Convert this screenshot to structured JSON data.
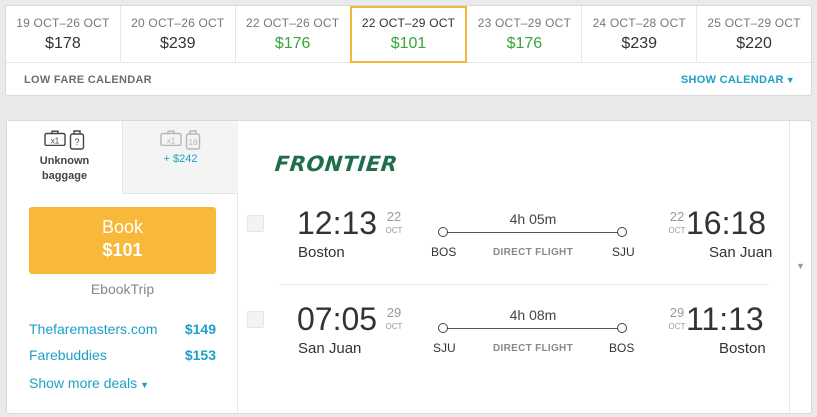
{
  "calendar": {
    "dates": [
      {
        "range": "19 OCT–26 OCT",
        "price": "$178",
        "cheap": false,
        "selected": false
      },
      {
        "range": "20 OCT–26 OCT",
        "price": "$239",
        "cheap": false,
        "selected": false
      },
      {
        "range": "22 OCT–26 OCT",
        "price": "$176",
        "cheap": true,
        "selected": false
      },
      {
        "range": "22 OCT–29 OCT",
        "price": "$101",
        "cheap": true,
        "selected": true
      },
      {
        "range": "23 OCT–29 OCT",
        "price": "$176",
        "cheap": true,
        "selected": false
      },
      {
        "range": "24 OCT–28 OCT",
        "price": "$239",
        "cheap": false,
        "selected": false
      },
      {
        "range": "25 OCT–29 OCT",
        "price": "$220",
        "cheap": false,
        "selected": false
      }
    ],
    "label": "LOW FARE CALENDAR",
    "show_label": "SHOW CALENDAR",
    "show_icon": "chevron-down-icon",
    "colors": {
      "cheap": "#3aa43a",
      "selected_border": "#f5b73b",
      "link": "#1ba0c8"
    }
  },
  "result": {
    "baggage": {
      "active_label": "Unknown baggage",
      "active_badge_1": "x1",
      "active_badge_2": "?",
      "inactive_badge_1": "x1",
      "inactive_badge_2": "18",
      "inactive_extra": "+ $242"
    },
    "book": {
      "label": "Book",
      "price": "$101",
      "color": "#f8b83a"
    },
    "provider": "EbookTrip",
    "deals": [
      {
        "name": "Thefaremasters.com",
        "price": "$149"
      },
      {
        "name": "Farebuddies",
        "price": "$153"
      }
    ],
    "more_deals": "Show more deals",
    "airline": "FRONTIER",
    "legs": [
      {
        "depart_time": "12:13",
        "depart_day": "22",
        "depart_month": "OCT",
        "depart_city": "Boston",
        "duration": "4h 05m",
        "from_code": "BOS",
        "to_code": "SJU",
        "stops": "DIRECT FLIGHT",
        "arrive_day": "22",
        "arrive_month": "OCT",
        "arrive_time": "16:18",
        "arrive_city": "San Juan"
      },
      {
        "depart_time": "07:05",
        "depart_day": "29",
        "depart_month": "OCT",
        "depart_city": "San Juan",
        "duration": "4h 08m",
        "from_code": "SJU",
        "to_code": "BOS",
        "stops": "DIRECT FLIGHT",
        "arrive_day": "29",
        "arrive_month": "OCT",
        "arrive_time": "11:13",
        "arrive_city": "Boston"
      }
    ]
  }
}
